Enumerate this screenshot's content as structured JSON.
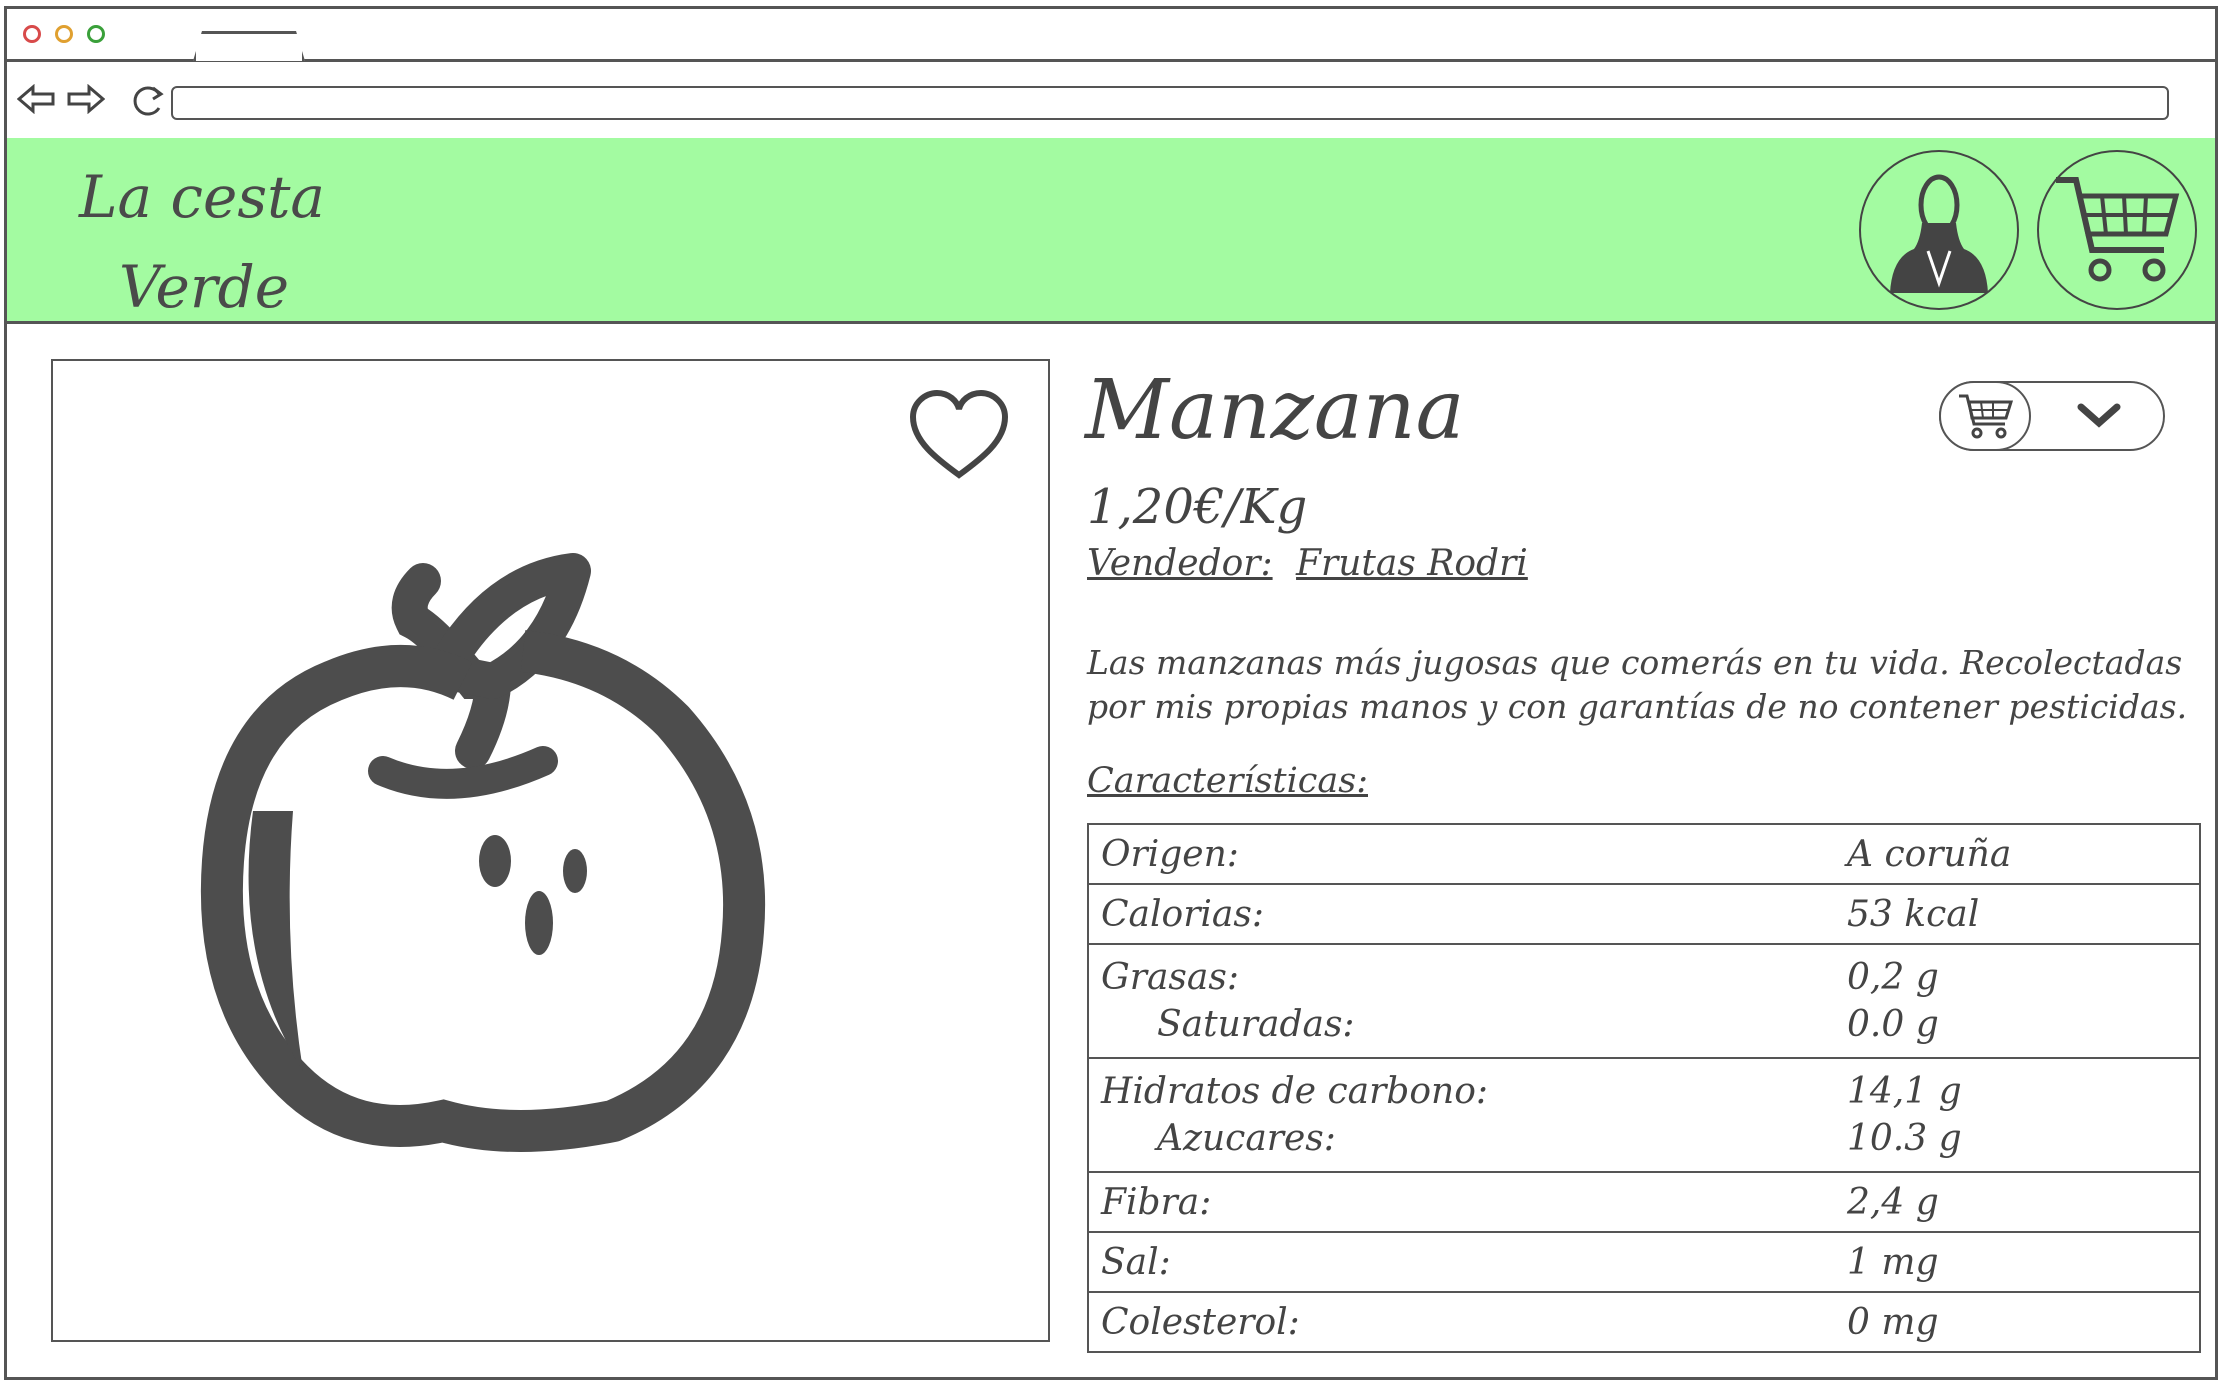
{
  "header": {
    "logo_line1": "La cesta",
    "logo_line2": "Verde",
    "background": "#a3fba1"
  },
  "icons": {
    "back": "arrow-left",
    "forward": "arrow-right",
    "reload": "reload",
    "user": "user-avatar",
    "cart": "shopping-cart",
    "favorite": "heart",
    "chevron": "chevron-down"
  },
  "product": {
    "name": "Manzana",
    "price": "1,20€/Kg",
    "seller_label": "Vendedor:",
    "seller_name": "Frutas Rodri",
    "description": "Las manzanas más jugosas que comerás en tu vida. Recolectadas por mis propias manos y con garantías de no contener pesticidas.",
    "characteristics_label": "Características:"
  },
  "specs": [
    {
      "label": "Origen:",
      "value": "A coruña"
    },
    {
      "label": "Calorias:",
      "value": "53 kcal"
    },
    {
      "label": "Grasas:",
      "value": "0,2 g",
      "sub_label": "Saturadas:",
      "sub_value": "0.0 g"
    },
    {
      "label": "Hidratos de carbono:",
      "value": "14,1 g",
      "sub_label": "Azucares:",
      "sub_value": "10.3 g"
    },
    {
      "label": "Fibra:",
      "value": "2,4 g"
    },
    {
      "label": "Sal:",
      "value": "1 mg"
    },
    {
      "label": "Colesterol:",
      "value": "0 mg"
    }
  ]
}
